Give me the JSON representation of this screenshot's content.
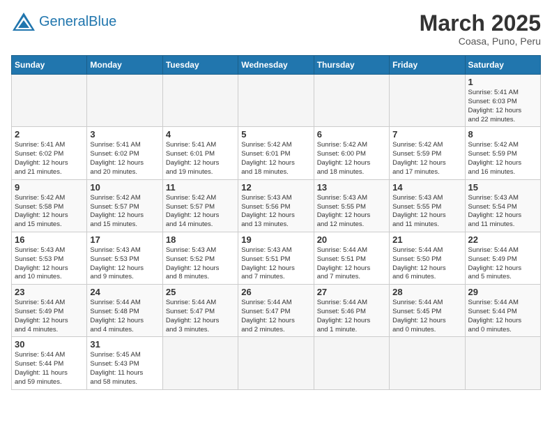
{
  "header": {
    "logo_general": "General",
    "logo_blue": "Blue",
    "month_title": "March 2025",
    "location": "Coasa, Puno, Peru"
  },
  "weekdays": [
    "Sunday",
    "Monday",
    "Tuesday",
    "Wednesday",
    "Thursday",
    "Friday",
    "Saturday"
  ],
  "weeks": [
    [
      {
        "day": "",
        "info": ""
      },
      {
        "day": "",
        "info": ""
      },
      {
        "day": "",
        "info": ""
      },
      {
        "day": "",
        "info": ""
      },
      {
        "day": "",
        "info": ""
      },
      {
        "day": "",
        "info": ""
      },
      {
        "day": "1",
        "info": "Sunrise: 5:41 AM\nSunset: 6:03 PM\nDaylight: 12 hours\nand 22 minutes."
      }
    ],
    [
      {
        "day": "2",
        "info": "Sunrise: 5:41 AM\nSunset: 6:02 PM\nDaylight: 12 hours\nand 21 minutes."
      },
      {
        "day": "3",
        "info": "Sunrise: 5:41 AM\nSunset: 6:02 PM\nDaylight: 12 hours\nand 20 minutes."
      },
      {
        "day": "4",
        "info": "Sunrise: 5:41 AM\nSunset: 6:01 PM\nDaylight: 12 hours\nand 19 minutes."
      },
      {
        "day": "5",
        "info": "Sunrise: 5:42 AM\nSunset: 6:01 PM\nDaylight: 12 hours\nand 18 minutes."
      },
      {
        "day": "6",
        "info": "Sunrise: 5:42 AM\nSunset: 6:00 PM\nDaylight: 12 hours\nand 18 minutes."
      },
      {
        "day": "7",
        "info": "Sunrise: 5:42 AM\nSunset: 5:59 PM\nDaylight: 12 hours\nand 17 minutes."
      },
      {
        "day": "8",
        "info": "Sunrise: 5:42 AM\nSunset: 5:59 PM\nDaylight: 12 hours\nand 16 minutes."
      }
    ],
    [
      {
        "day": "9",
        "info": "Sunrise: 5:42 AM\nSunset: 5:58 PM\nDaylight: 12 hours\nand 15 minutes."
      },
      {
        "day": "10",
        "info": "Sunrise: 5:42 AM\nSunset: 5:57 PM\nDaylight: 12 hours\nand 15 minutes."
      },
      {
        "day": "11",
        "info": "Sunrise: 5:42 AM\nSunset: 5:57 PM\nDaylight: 12 hours\nand 14 minutes."
      },
      {
        "day": "12",
        "info": "Sunrise: 5:43 AM\nSunset: 5:56 PM\nDaylight: 12 hours\nand 13 minutes."
      },
      {
        "day": "13",
        "info": "Sunrise: 5:43 AM\nSunset: 5:55 PM\nDaylight: 12 hours\nand 12 minutes."
      },
      {
        "day": "14",
        "info": "Sunrise: 5:43 AM\nSunset: 5:55 PM\nDaylight: 12 hours\nand 11 minutes."
      },
      {
        "day": "15",
        "info": "Sunrise: 5:43 AM\nSunset: 5:54 PM\nDaylight: 12 hours\nand 11 minutes."
      }
    ],
    [
      {
        "day": "16",
        "info": "Sunrise: 5:43 AM\nSunset: 5:53 PM\nDaylight: 12 hours\nand 10 minutes."
      },
      {
        "day": "17",
        "info": "Sunrise: 5:43 AM\nSunset: 5:53 PM\nDaylight: 12 hours\nand 9 minutes."
      },
      {
        "day": "18",
        "info": "Sunrise: 5:43 AM\nSunset: 5:52 PM\nDaylight: 12 hours\nand 8 minutes."
      },
      {
        "day": "19",
        "info": "Sunrise: 5:43 AM\nSunset: 5:51 PM\nDaylight: 12 hours\nand 7 minutes."
      },
      {
        "day": "20",
        "info": "Sunrise: 5:44 AM\nSunset: 5:51 PM\nDaylight: 12 hours\nand 7 minutes."
      },
      {
        "day": "21",
        "info": "Sunrise: 5:44 AM\nSunset: 5:50 PM\nDaylight: 12 hours\nand 6 minutes."
      },
      {
        "day": "22",
        "info": "Sunrise: 5:44 AM\nSunset: 5:49 PM\nDaylight: 12 hours\nand 5 minutes."
      }
    ],
    [
      {
        "day": "23",
        "info": "Sunrise: 5:44 AM\nSunset: 5:49 PM\nDaylight: 12 hours\nand 4 minutes."
      },
      {
        "day": "24",
        "info": "Sunrise: 5:44 AM\nSunset: 5:48 PM\nDaylight: 12 hours\nand 4 minutes."
      },
      {
        "day": "25",
        "info": "Sunrise: 5:44 AM\nSunset: 5:47 PM\nDaylight: 12 hours\nand 3 minutes."
      },
      {
        "day": "26",
        "info": "Sunrise: 5:44 AM\nSunset: 5:47 PM\nDaylight: 12 hours\nand 2 minutes."
      },
      {
        "day": "27",
        "info": "Sunrise: 5:44 AM\nSunset: 5:46 PM\nDaylight: 12 hours\nand 1 minute."
      },
      {
        "day": "28",
        "info": "Sunrise: 5:44 AM\nSunset: 5:45 PM\nDaylight: 12 hours\nand 0 minutes."
      },
      {
        "day": "29",
        "info": "Sunrise: 5:44 AM\nSunset: 5:44 PM\nDaylight: 12 hours\nand 0 minutes."
      }
    ],
    [
      {
        "day": "30",
        "info": "Sunrise: 5:44 AM\nSunset: 5:44 PM\nDaylight: 11 hours\nand 59 minutes."
      },
      {
        "day": "31",
        "info": "Sunrise: 5:45 AM\nSunset: 5:43 PM\nDaylight: 11 hours\nand 58 minutes."
      },
      {
        "day": "",
        "info": ""
      },
      {
        "day": "",
        "info": ""
      },
      {
        "day": "",
        "info": ""
      },
      {
        "day": "",
        "info": ""
      },
      {
        "day": "",
        "info": ""
      }
    ]
  ]
}
